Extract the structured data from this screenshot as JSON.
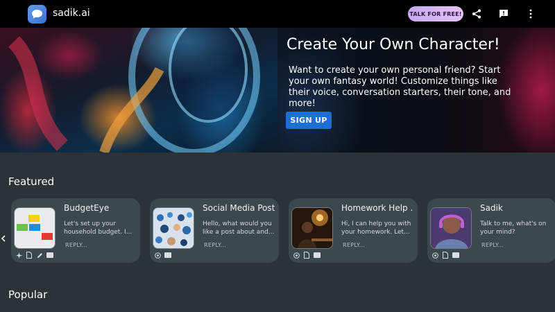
{
  "header": {
    "brand": "sadik.ai",
    "talk_button": "TALK FOR FREE!"
  },
  "hero": {
    "title": "Create Your Own Character!",
    "description": "Want to create your own personal friend? Start your own fantasy world! Customize things like their voice, conversation starters, their tone, and more!",
    "signup_button": "SIGN UP"
  },
  "featured": {
    "title": "Featured",
    "cards": [
      {
        "name": "BudgetEye",
        "description": "Let's set up your household budget. I...",
        "reply": "REPLY..."
      },
      {
        "name": "Social Media Post...",
        "description": "Hello, what would you like a post about and...",
        "reply": "REPLY..."
      },
      {
        "name": "Homework Help ...",
        "description": "Hi, I can help you with your homework. Let...",
        "reply": "REPLY..."
      },
      {
        "name": "Sadik",
        "description": "Talk to me, what's on your mind?",
        "reply": "REPLY..."
      }
    ]
  },
  "popular": {
    "title": "Popular"
  },
  "colors": {
    "background": "#2b3338",
    "card": "#3d484e",
    "accent_blue": "#1d6fd1",
    "talk_button": "#d8b8f4"
  },
  "icons": [
    "chat-logo-icon",
    "share-icon",
    "feedback-icon",
    "more-vert-icon",
    "chevron-left-icon",
    "chevron-right-icon",
    "sparkle-icon",
    "document-icon",
    "pencil-icon",
    "image-icon",
    "globe-icon"
  ]
}
